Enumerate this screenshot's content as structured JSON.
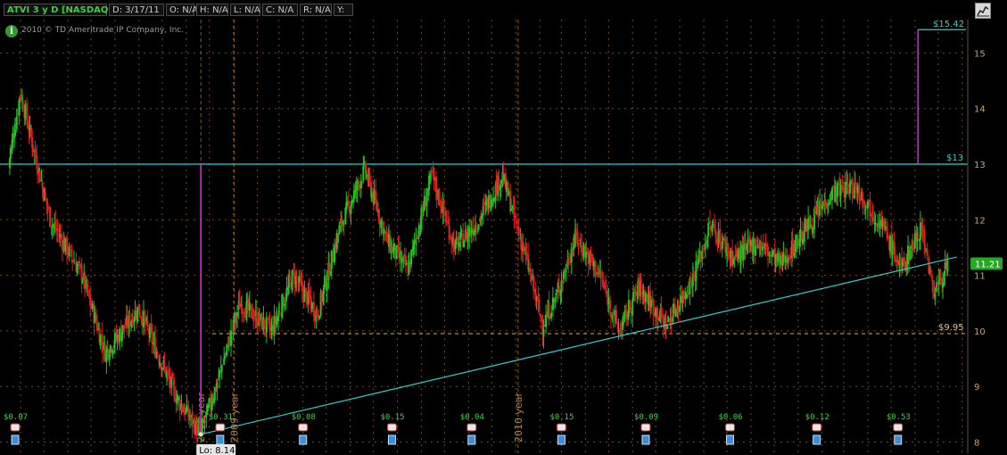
{
  "header": {
    "symbol": "ATVI 3 y D [NASDAQ]",
    "date": "D: 3/17/11",
    "open": "O: N/A",
    "high": "H: N/A",
    "low": "L: N/A",
    "close": "C: N/A",
    "range": "R: N/A",
    "y": "Y:"
  },
  "copyright": "2010 © TD Ameritrade IP Company, Inc.",
  "icons": {
    "info": "info-icon",
    "chart_button": "chart-style-icon",
    "dividend": "dividend-icon",
    "earnings": "earnings-icon"
  },
  "colors": {
    "up": "#22c822",
    "down": "#e02020",
    "trendline": "#33cccc",
    "marker": "#e020e0",
    "support": "#d9a86a",
    "grid": "#7a4a10",
    "axis_text": "#d2a06a"
  },
  "chart_data": {
    "type": "candlestick",
    "title": "ATVI 3 y D [NASDAQ]",
    "x_range": [
      "2008-03",
      "2011-03-17"
    ],
    "ylim": [
      7.8,
      15.6
    ],
    "y_ticks": [
      8,
      9,
      10,
      11,
      12,
      13,
      14,
      15
    ],
    "year_labels": [
      {
        "label": "2008 year",
        "date": "2008-11-20"
      },
      {
        "label": "2009 year",
        "date": "2009-01-02"
      },
      {
        "label": "2010 year",
        "date": "2010-01-04"
      }
    ],
    "price_anchors": [
      {
        "date": "2008-03-17",
        "close": 13.0
      },
      {
        "date": "2008-04-01",
        "close": 14.3
      },
      {
        "date": "2008-05-10",
        "close": 12.0
      },
      {
        "date": "2008-06-20",
        "close": 11.0
      },
      {
        "date": "2008-07-20",
        "close": 9.6
      },
      {
        "date": "2008-09-01",
        "close": 10.4
      },
      {
        "date": "2008-10-20",
        "close": 8.8
      },
      {
        "date": "2008-11-20",
        "close": 8.14
      },
      {
        "date": "2008-12-10",
        "close": 9.0
      },
      {
        "date": "2009-01-10",
        "close": 10.5
      },
      {
        "date": "2009-02-20",
        "close": 10.0
      },
      {
        "date": "2009-03-20",
        "close": 11.0
      },
      {
        "date": "2009-04-20",
        "close": 10.3
      },
      {
        "date": "2009-05-20",
        "close": 11.9
      },
      {
        "date": "2009-06-20",
        "close": 12.9
      },
      {
        "date": "2009-07-20",
        "close": 11.6
      },
      {
        "date": "2009-08-15",
        "close": 11.1
      },
      {
        "date": "2009-09-15",
        "close": 12.8
      },
      {
        "date": "2009-10-15",
        "close": 11.5
      },
      {
        "date": "2009-11-15",
        "close": 12.0
      },
      {
        "date": "2009-12-15",
        "close": 12.8
      },
      {
        "date": "2010-01-15",
        "close": 11.3
      },
      {
        "date": "2010-02-05",
        "close": 10.1
      },
      {
        "date": "2010-02-25",
        "close": 10.7
      },
      {
        "date": "2010-03-20",
        "close": 11.7
      },
      {
        "date": "2010-04-20",
        "close": 11.0
      },
      {
        "date": "2010-05-15",
        "close": 10.0
      },
      {
        "date": "2010-06-10",
        "close": 10.8
      },
      {
        "date": "2010-07-15",
        "close": 10.1
      },
      {
        "date": "2010-08-20",
        "close": 11.0
      },
      {
        "date": "2010-09-10",
        "close": 11.9
      },
      {
        "date": "2010-10-10",
        "close": 11.3
      },
      {
        "date": "2010-11-10",
        "close": 11.6
      },
      {
        "date": "2010-12-10",
        "close": 11.2
      },
      {
        "date": "2011-01-20",
        "close": 12.0
      },
      {
        "date": "2011-02-15",
        "close": 12.5
      },
      {
        "date": "2011-03-17",
        "close": 12.6
      },
      {
        "date": "2011-04-20",
        "close": 11.9
      },
      {
        "date": "2011-05-15",
        "close": 11.1
      },
      {
        "date": "2011-06-10",
        "close": 11.9
      },
      {
        "date": "2011-06-25",
        "close": 10.7
      },
      {
        "date": "2011-07-15",
        "close": 11.21
      }
    ],
    "last_price": "11.21",
    "levels": [
      {
        "label": "$15.42",
        "value": 15.42,
        "color": "#33cccc"
      },
      {
        "label": "$13",
        "value": 13.0,
        "color": "#33cccc"
      },
      {
        "label": "$9.95",
        "value": 9.95,
        "color": "#d9a86a"
      }
    ],
    "low_label": "Lo: 8.14",
    "low_value": 8.14,
    "trendline": {
      "from": {
        "date": "2008-11-20",
        "value": 8.14
      },
      "to": {
        "date": "2011-07-25",
        "value": 11.33
      }
    },
    "dividends": [
      {
        "label": "$0.07",
        "date": "2008-03-25"
      },
      {
        "label": "$0.31",
        "date": "2008-12-15"
      },
      {
        "label": "$0.08",
        "date": "2009-04-01"
      },
      {
        "label": "$0.15",
        "date": "2009-07-25"
      },
      {
        "label": "$0.04",
        "date": "2009-11-05"
      },
      {
        "label": "$0.15",
        "date": "2010-03-01"
      },
      {
        "label": "$0.09",
        "date": "2010-06-18"
      },
      {
        "label": "$0.06",
        "date": "2010-10-05"
      },
      {
        "label": "$0.12",
        "date": "2011-01-25"
      },
      {
        "label": "$0.53",
        "date": "2011-05-10"
      }
    ]
  }
}
